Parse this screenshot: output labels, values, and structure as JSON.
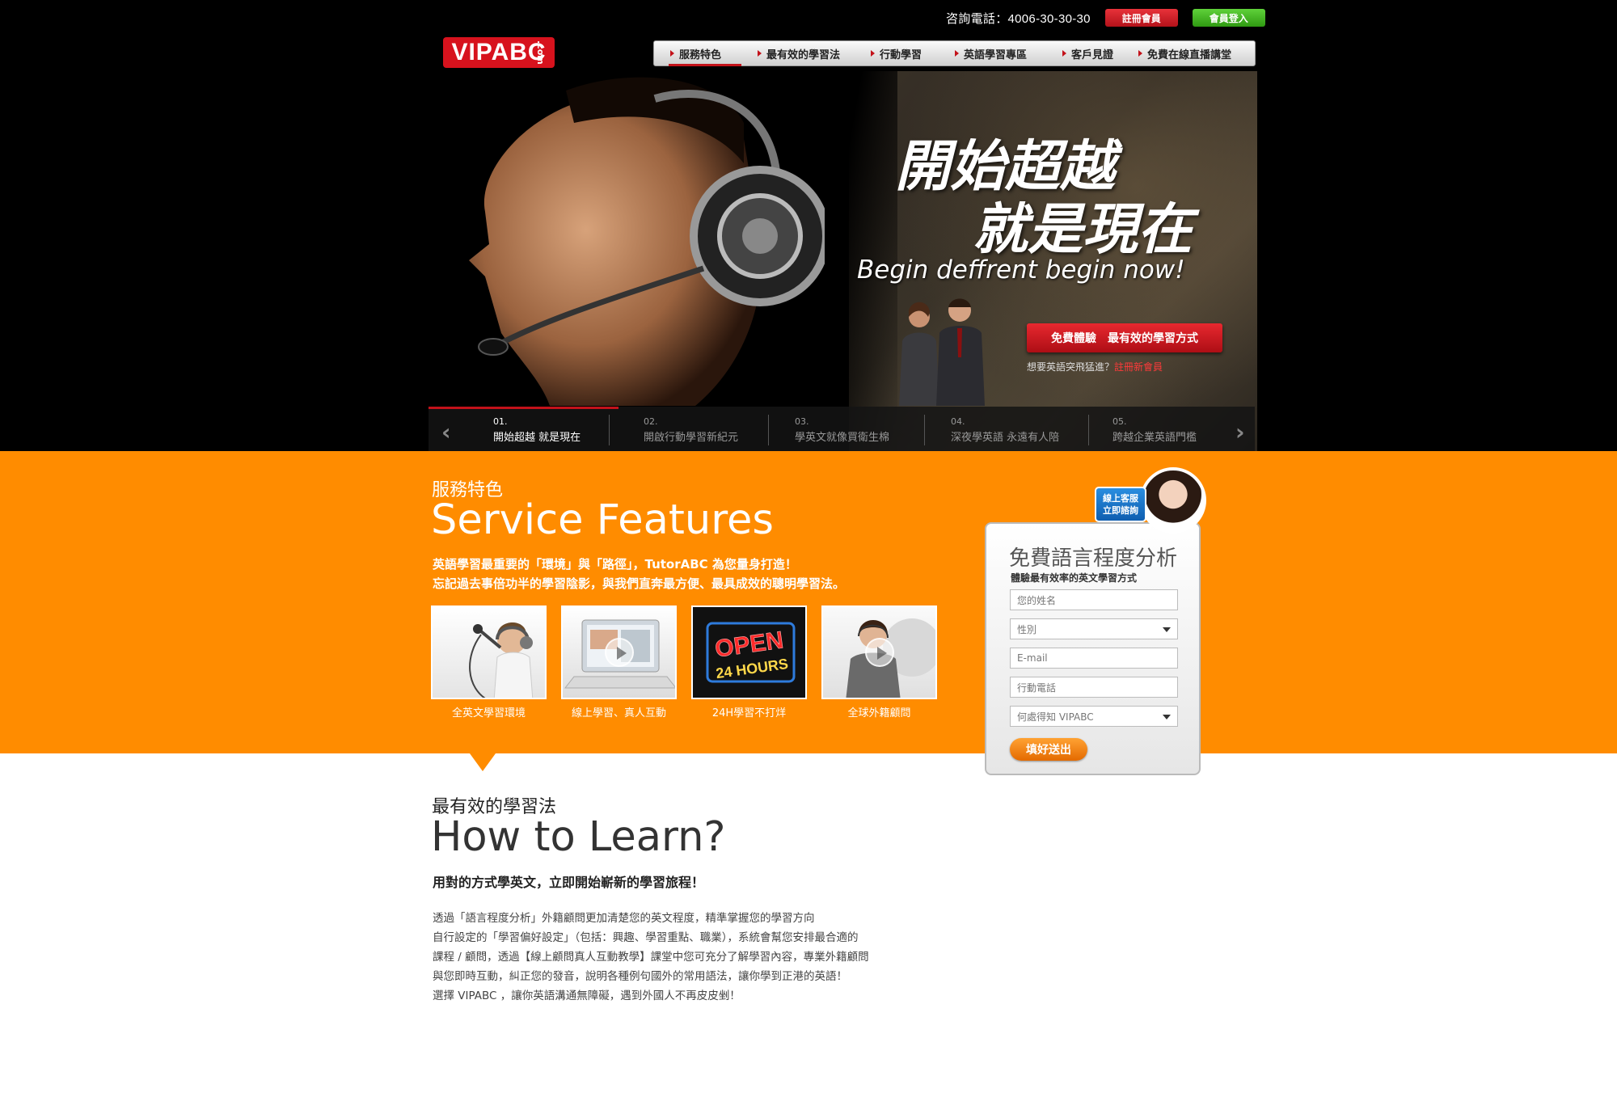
{
  "header": {
    "hotline": "咨詢電話：4006-30-30-30",
    "register_label": "註冊會員",
    "login_label": "會員登入",
    "logo_text": "VIPABC",
    "logo_suffix": ".com"
  },
  "nav": {
    "items": [
      {
        "label": "服務特色"
      },
      {
        "label": "最有效的學習法"
      },
      {
        "label": "行動學習"
      },
      {
        "label": "英語學習專區"
      },
      {
        "label": "客戶見證"
      },
      {
        "label": "免費在線直播講堂"
      }
    ]
  },
  "hero": {
    "headline_line1": "開始超越",
    "headline_line2": "就是現在",
    "tagline": "Begin deffrent begin now!",
    "cta_label": "免費體驗　最有效的學習方式",
    "cta_sub_text": "想要英語突飛猛進？",
    "cta_sub_link": "註冊新會員"
  },
  "slides": [
    {
      "num": "01.",
      "label": "開始超越 就是現在"
    },
    {
      "num": "02.",
      "label": "開啟行動學習新紀元"
    },
    {
      "num": "03.",
      "label": "學英文就像買衛生棉"
    },
    {
      "num": "04.",
      "label": "深夜學英語  永遠有人陪"
    },
    {
      "num": "05.",
      "label": "跨越企業英語門檻"
    }
  ],
  "service": {
    "title_cn": "服務特色",
    "title_en": "Service Features",
    "desc_line1": "英語學習最重要的「環境」與「路徑」，TutorABC 為您量身打造！",
    "desc_line2": "忘記過去事倍功半的學習陰影，與我們直奔最方便、最具成效的聰明學習法。",
    "features": [
      {
        "label": "全英文學習環境"
      },
      {
        "label": "線上學習、真人互動"
      },
      {
        "label": "24H學習不打烊"
      },
      {
        "label": "全球外籍顧問"
      }
    ],
    "open_sign_line1": "OPEN",
    "open_sign_line2": "24 HOURS"
  },
  "form": {
    "help_label_line1": "線上客服",
    "help_label_line2": "立即諮詢",
    "title": "免費語言程度分析",
    "subtitle": "體驗最有效率的英文學習方式",
    "name_placeholder": "您的姓名",
    "gender_placeholder": "性別",
    "email_placeholder": "E-mail",
    "phone_placeholder": "行動電話",
    "source_placeholder": "何處得知 VIPABC",
    "submit_label": "填好送出"
  },
  "learn": {
    "title_cn": "最有效的學習法",
    "title_en": "How to Learn?",
    "lead": "用對的方式學英文，立即開始嶄新的學習旅程！",
    "body_lines": [
      "透過「語言程度分析」外籍顧問更加清楚您的英文程度，精準掌握您的學習方向",
      "自行設定的「學習偏好設定」（包括：興趣、學習重點、職業），系統會幫您安排最合適的",
      "課程 / 顧問，透過【線上顧問真人互動教學】課堂中您可充分了解學習內容，專業外籍顧問",
      "與您即時互動，糾正您的發音，說明各種例句國外的常用語法，讓你學到正港的英語！",
      "選擇 VIPABC ，讓你英語溝通無障礙，遇到外國人不再皮皮剉！"
    ]
  },
  "colors": {
    "brand_red": "#d7121d",
    "orange": "#ff8c00",
    "login_green": "#3cae1c"
  }
}
